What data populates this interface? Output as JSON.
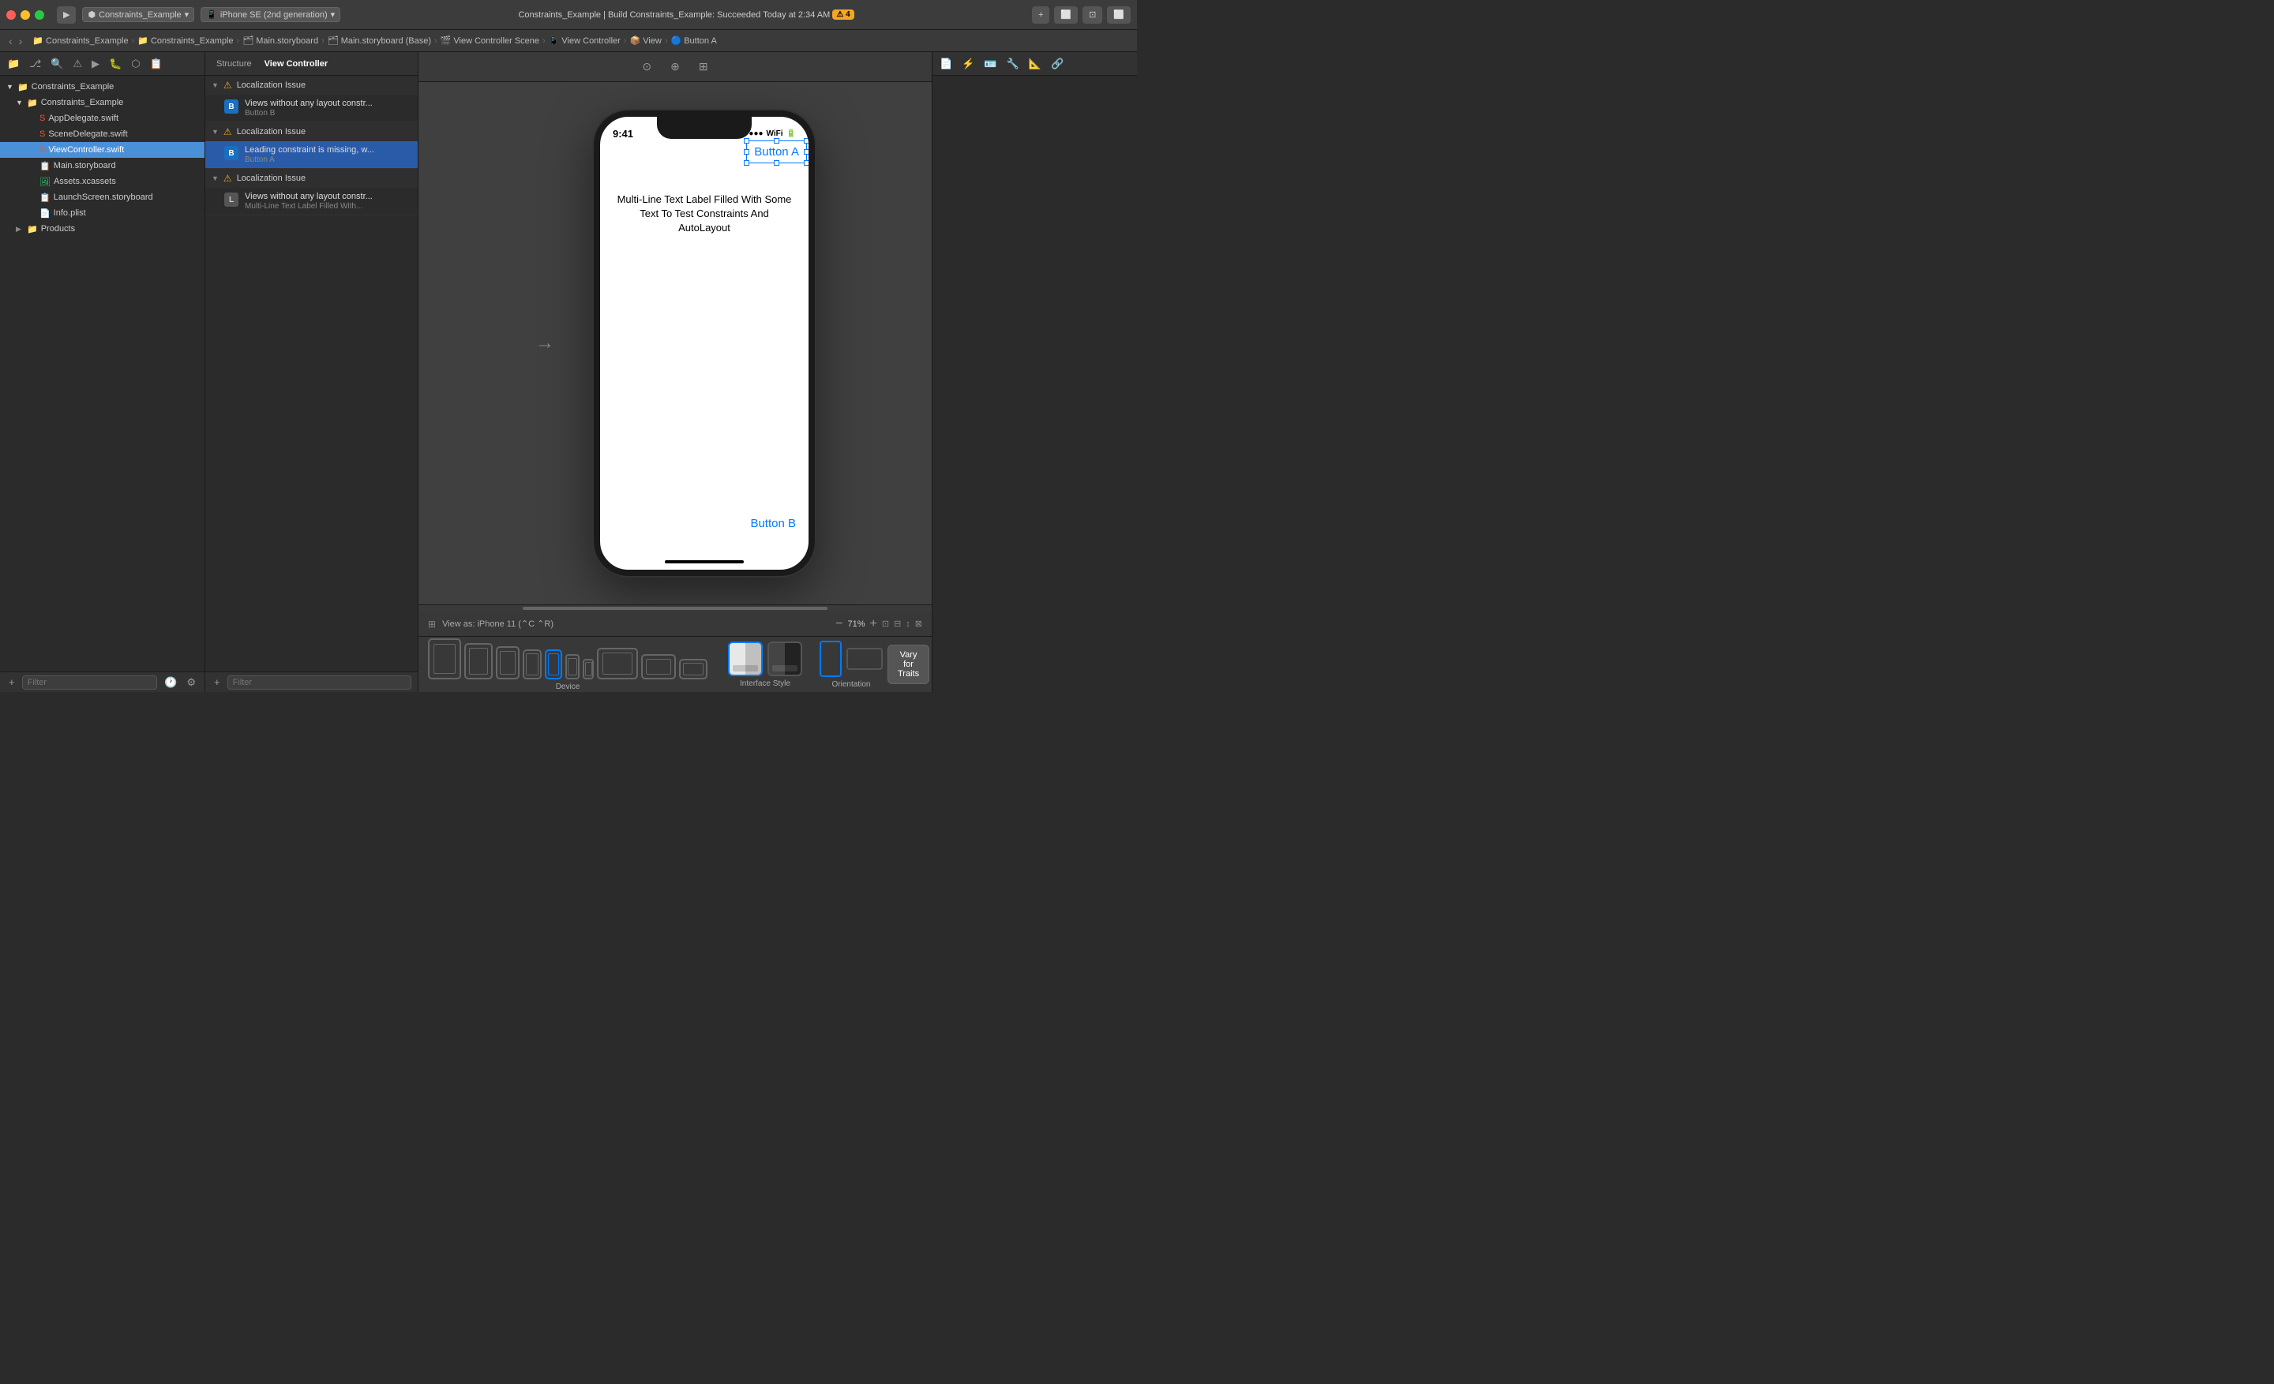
{
  "titlebar": {
    "traffic_lights": [
      "red",
      "yellow",
      "green"
    ],
    "run_btn_label": "▶",
    "scheme_label": "Constraints_Example",
    "device_label": "iPhone SE (2nd generation)",
    "build_status": "Constraints_Example | Build Constraints_Example: Succeeded",
    "build_time": "Today at 2:34 AM",
    "warning_count": "⚠ 4",
    "add_btn": "+",
    "window_controls": [
      "tile-left",
      "fullscreen",
      "tile-right"
    ]
  },
  "breadcrumb": {
    "items": [
      {
        "icon": "📁",
        "label": "Constraints_Example"
      },
      {
        "icon": "📁",
        "label": "Constraints_Example"
      },
      {
        "icon": "🗂",
        "label": "Main.storyboard"
      },
      {
        "icon": "🗂",
        "label": "Main.storyboard (Base)"
      },
      {
        "icon": "🎬",
        "label": "View Controller Scene"
      },
      {
        "icon": "📱",
        "label": "View Controller"
      },
      {
        "icon": "📦",
        "label": "View"
      },
      {
        "icon": "🔵",
        "label": "Button A"
      }
    ]
  },
  "navigator": {
    "root": {
      "label": "Constraints_Example",
      "icon": "folder",
      "expanded": true
    },
    "items": [
      {
        "label": "Constraints_Example",
        "icon": "folder",
        "indent": 1,
        "expanded": true
      },
      {
        "label": "AppDelegate.swift",
        "icon": "swift",
        "indent": 2
      },
      {
        "label": "SceneDelegate.swift",
        "icon": "swift",
        "indent": 2
      },
      {
        "label": "ViewController.swift",
        "icon": "swift",
        "indent": 2,
        "selected": true
      },
      {
        "label": "Main.storyboard",
        "icon": "storyboard",
        "indent": 2
      },
      {
        "label": "Assets.xcassets",
        "icon": "xcassets",
        "indent": 2
      },
      {
        "label": "LaunchScreen.storyboard",
        "icon": "storyboard",
        "indent": 2
      },
      {
        "label": "Info.plist",
        "icon": "plist",
        "indent": 2
      },
      {
        "label": "Products",
        "icon": "folder",
        "indent": 1
      }
    ],
    "filter_placeholder": "Filter"
  },
  "issues": {
    "header": {
      "structure_label": "Structure",
      "view_controller_label": "View Controller"
    },
    "groups": [
      {
        "title": "Localization Issue",
        "warning": true,
        "items": [
          {
            "icon_type": "button",
            "title": "Views without any layout constr...",
            "subtitle": "Button B"
          }
        ]
      },
      {
        "title": "Localization Issue",
        "warning": true,
        "selected_item": 0,
        "items": [
          {
            "icon_type": "button",
            "title": "Leading constraint is missing, w...",
            "subtitle": "Button A",
            "selected": true
          }
        ]
      },
      {
        "title": "Localization Issue",
        "warning": true,
        "items": [
          {
            "icon_type": "label",
            "title": "Views without any layout constr...",
            "subtitle": "Multi-Line Text Label Filled With..."
          }
        ]
      }
    ],
    "filter_placeholder": "Filter"
  },
  "canvas": {
    "iphone_model": "iPhone SE (2nd generation)",
    "status_time": "9:41",
    "button_a_label": "Button A",
    "button_b_label": "Button B",
    "label_text": "Multi-Line Text Label Filled With Some Text To Test Constraints And AutoLayout",
    "view_as_label": "View as: iPhone 11 (⌃C ⌃R)",
    "zoom_minus": "−",
    "zoom_value": "71%",
    "zoom_plus": "+"
  },
  "bottom_bar": {
    "device_label": "Device",
    "interface_style_label": "Interface Style",
    "orientation_label": "Orientation",
    "vary_traits_label": "Vary for Traits"
  }
}
